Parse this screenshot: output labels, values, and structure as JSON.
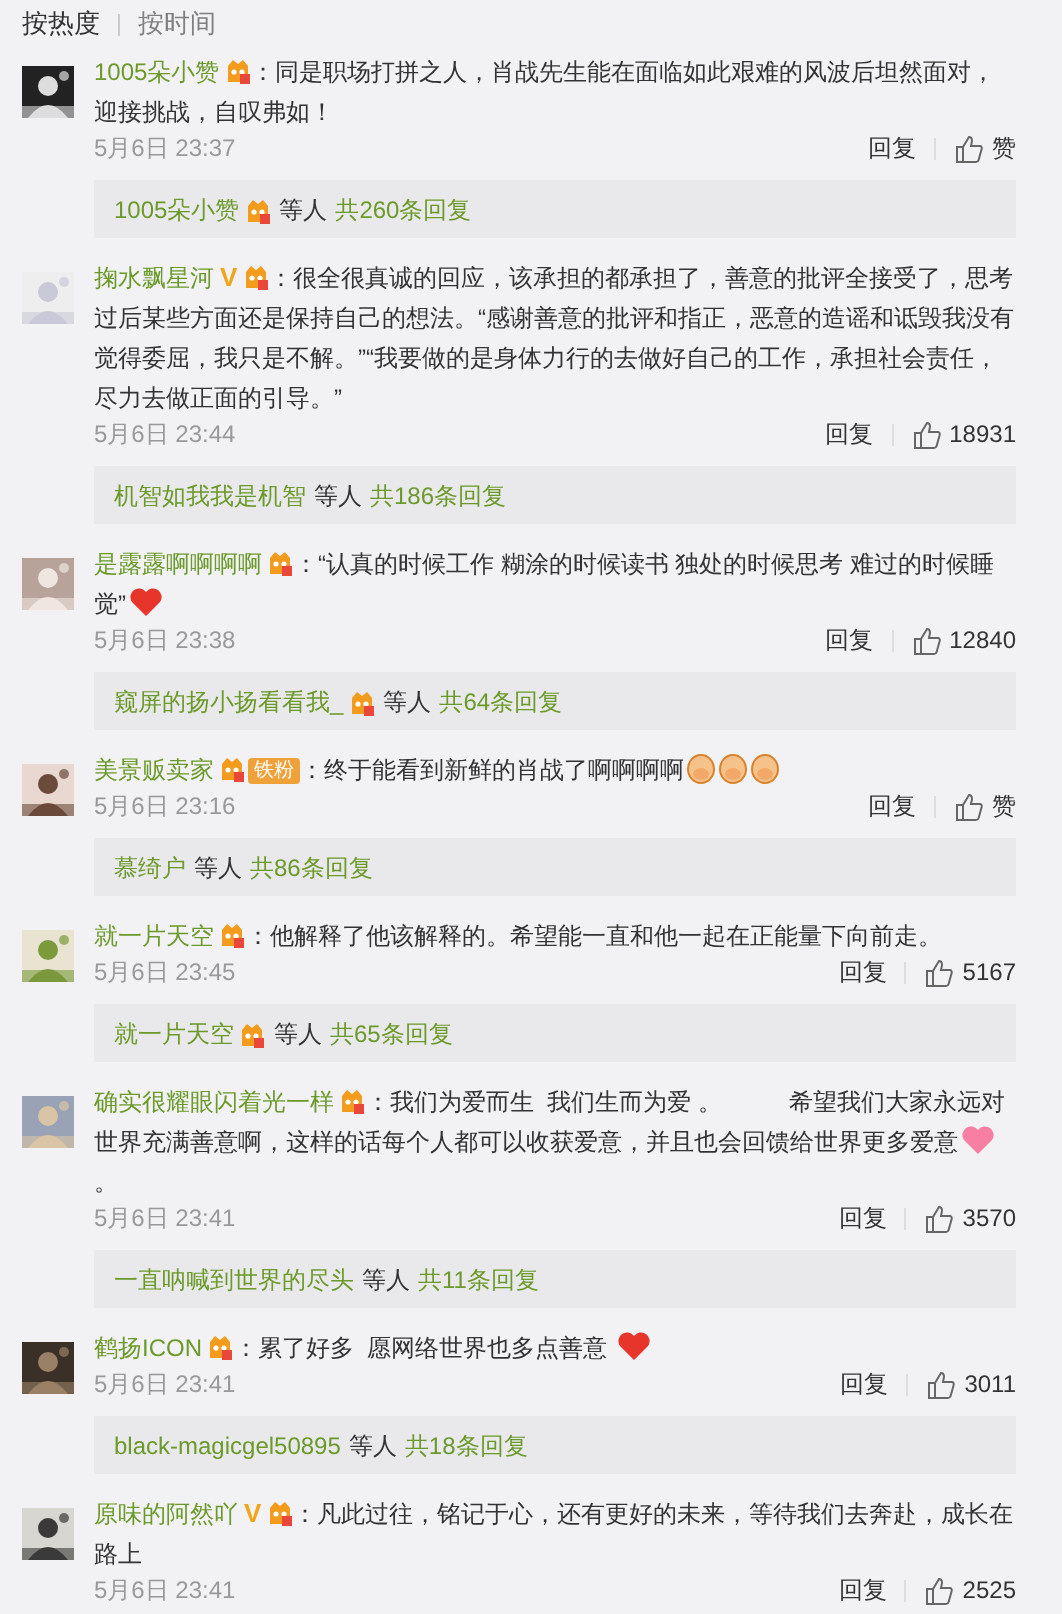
{
  "sort_tabs": [
    {
      "label": "按热度",
      "selected": true
    },
    {
      "label": "按时间",
      "selected": false
    }
  ],
  "comments": [
    {
      "user": "1005朵小赞",
      "badges": [
        {
          "kind": "member"
        }
      ],
      "content": [
        {
          "kind": "text",
          "text": "：同是职场打拼之人，肖战先生能在面临如此艰难的风波后坦然面对，迎接挑战，自叹弗如！"
        }
      ],
      "time": "5月6日 23:37",
      "reply_label": "回复",
      "likes": "赞",
      "replies": {
        "user": "1005朵小赞",
        "badges": [
          {
            "kind": "member"
          }
        ],
        "others": "等人",
        "count": "共260条回复"
      }
    },
    {
      "user": "掬水飘星河",
      "badges": [
        {
          "kind": "v",
          "text": "V"
        },
        {
          "kind": "member"
        }
      ],
      "content": [
        {
          "kind": "text",
          "text": "：很全很真诚的回应，该承担的都承担了，善意的批评全接受了，思考过后某些方面还是保持自己的想法。“感谢善意的批评和指正，恶意的造谣和诋毁我没有觉得委屈，我只是不解。”“我要做的是身体力行的去做好自己的工作，承担社会责任，尽力去做正面的引导。”"
        }
      ],
      "time": "5月6日 23:44",
      "reply_label": "回复",
      "likes": "18931",
      "replies": {
        "user": "机智如我我是机智",
        "others": "等人",
        "count": "共186条回复"
      }
    },
    {
      "user": "是露露啊啊啊啊",
      "badges": [
        {
          "kind": "member"
        }
      ],
      "content": [
        {
          "kind": "text",
          "text": "：“认真的时候工作 糊涂的时候读书 独处的时候思考 难过的时候睡觉”"
        },
        {
          "kind": "heart"
        }
      ],
      "time": "5月6日 23:38",
      "reply_label": "回复",
      "likes": "12840",
      "replies": {
        "user": "窥屏的扬小扬看看我_",
        "badges": [
          {
            "kind": "member"
          }
        ],
        "others": "等人",
        "count": "共64条回复"
      }
    },
    {
      "user": "美景贩卖家",
      "badges": [
        {
          "kind": "fan",
          "text": "铁粉"
        }
      ],
      "content": [
        {
          "kind": "text",
          "text": "：终于能看到新鲜的肖战了啊啊啊啊"
        },
        {
          "kind": "emoji"
        },
        {
          "kind": "emoji"
        },
        {
          "kind": "emoji"
        }
      ],
      "time": "5月6日 23:16",
      "reply_label": "回复",
      "likes": "赞",
      "replies": {
        "user": "慕绮户",
        "others": "等人",
        "count": "共86条回复"
      }
    },
    {
      "user": "就一片天空",
      "badges": [
        {
          "kind": "member"
        }
      ],
      "content": [
        {
          "kind": "text",
          "text": "：他解释了他该解释的。希望能一直和他一起在正能量下向前走。"
        }
      ],
      "time": "5月6日 23:45",
      "reply_label": "回复",
      "likes": "5167",
      "replies": {
        "user": "就一片天空",
        "badges": [
          {
            "kind": "member"
          }
        ],
        "others": "等人",
        "count": "共65条回复"
      }
    },
    {
      "user": "确实很耀眼闪着光一样",
      "badges": [
        {
          "kind": "member"
        }
      ],
      "content": [
        {
          "kind": "text",
          "text": "：我们为爱而生  我们生而为爱 。          希望我们大家永远对世界充满善意啊，这样的话每个人都可以收获爱意，并且也会回馈给世界更多爱意"
        },
        {
          "kind": "pink-heart"
        },
        {
          "kind": "text",
          "text": "。"
        }
      ],
      "time": "5月6日 23:41",
      "reply_label": "回复",
      "likes": "3570",
      "replies": {
        "user": "一直呐喊到世界的尽头",
        "others": "等人",
        "count": "共11条回复"
      }
    },
    {
      "user": "鹤扬ICON",
      "badges": [
        {
          "kind": "member"
        }
      ],
      "content": [
        {
          "kind": "text",
          "text": "：累了好多  愿网络世界也多点善意 "
        },
        {
          "kind": "heart"
        }
      ],
      "time": "5月6日 23:41",
      "reply_label": "回复",
      "likes": "3011",
      "replies": {
        "user": "black-magicgel50895",
        "others": "等人",
        "count": "共18条回复"
      }
    },
    {
      "user": "原味的阿然吖",
      "badges": [
        {
          "kind": "v",
          "text": "V"
        },
        {
          "kind": "member"
        }
      ],
      "content": [
        {
          "kind": "text",
          "text": "：凡此过往，铭记于心，还有更好的未来，等待我们去奔赴，成长在路上"
        }
      ],
      "time": "5月6日 23:41",
      "reply_label": "回复",
      "likes": "2525"
    }
  ]
}
